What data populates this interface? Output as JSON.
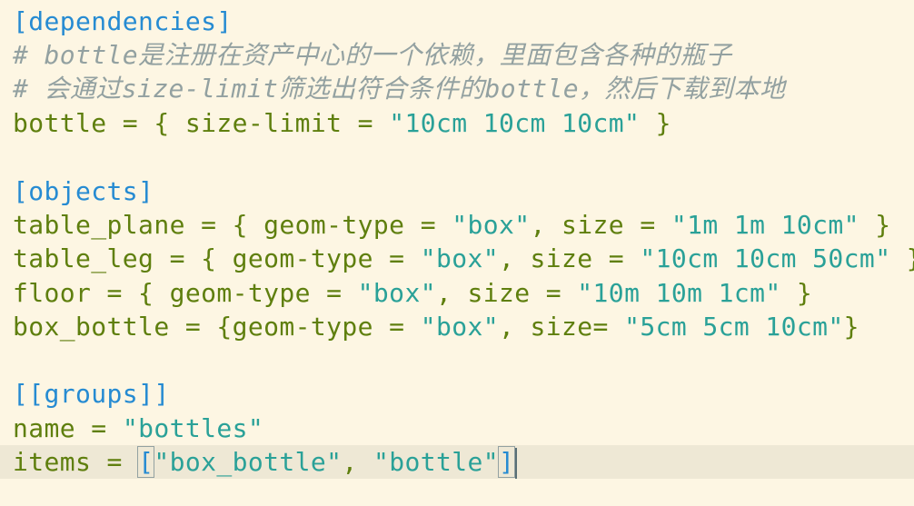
{
  "editor": {
    "lines": [
      {
        "tokens": [
          {
            "t": "section",
            "v": "[dependencies]"
          }
        ]
      },
      {
        "tokens": [
          {
            "t": "comment",
            "v": "# bottle是注册在资产中心的一个依赖，里面包含各种的瓶子"
          }
        ]
      },
      {
        "tokens": [
          {
            "t": "comment",
            "v": "# 会通过size-limit筛选出符合条件的bottle，然后下载到本地"
          }
        ]
      },
      {
        "tokens": [
          {
            "t": "key",
            "v": "bottle = { size-limit = "
          },
          {
            "t": "str",
            "v": "\"10cm 10cm 10cm\""
          },
          {
            "t": "punct",
            "v": " }"
          }
        ]
      },
      {
        "tokens": []
      },
      {
        "tokens": [
          {
            "t": "section",
            "v": "[objects]"
          }
        ]
      },
      {
        "tokens": [
          {
            "t": "key",
            "v": "table_plane = { geom-type = "
          },
          {
            "t": "str",
            "v": "\"box\""
          },
          {
            "t": "punct",
            "v": ", size = "
          },
          {
            "t": "str",
            "v": "\"1m 1m 10cm\""
          },
          {
            "t": "punct",
            "v": " }"
          }
        ]
      },
      {
        "tokens": [
          {
            "t": "key",
            "v": "table_leg = { geom-type = "
          },
          {
            "t": "str",
            "v": "\"box\""
          },
          {
            "t": "punct",
            "v": ", size = "
          },
          {
            "t": "str",
            "v": "\"10cm 10cm 50cm\""
          },
          {
            "t": "punct",
            "v": " }"
          }
        ]
      },
      {
        "tokens": [
          {
            "t": "key",
            "v": "floor = { geom-type = "
          },
          {
            "t": "str",
            "v": "\"box\""
          },
          {
            "t": "punct",
            "v": ", size = "
          },
          {
            "t": "str",
            "v": "\"10m 10m 1cm\""
          },
          {
            "t": "punct",
            "v": " }"
          }
        ]
      },
      {
        "tokens": [
          {
            "t": "key",
            "v": "box_bottle = {geom-type = "
          },
          {
            "t": "str",
            "v": "\"box\""
          },
          {
            "t": "punct",
            "v": ", size= "
          },
          {
            "t": "str",
            "v": "\"5cm 5cm 10cm\""
          },
          {
            "t": "punct",
            "v": "}"
          }
        ]
      },
      {
        "tokens": []
      },
      {
        "tokens": [
          {
            "t": "section",
            "v": "[[groups]]"
          }
        ]
      },
      {
        "tokens": [
          {
            "t": "key",
            "v": "name = "
          },
          {
            "t": "str",
            "v": "\"bottles\""
          }
        ]
      },
      {
        "current": true,
        "tokens": [
          {
            "t": "key",
            "v": "items = "
          },
          {
            "t": "bracket-match",
            "v": "["
          },
          {
            "t": "str",
            "v": "\"box_bottle\""
          },
          {
            "t": "punct",
            "v": ", "
          },
          {
            "t": "str",
            "v": "\"bottle\""
          },
          {
            "t": "bracket-match",
            "v": "]"
          },
          {
            "t": "cursor",
            "v": ""
          }
        ]
      }
    ]
  },
  "colors": {
    "background": "#fdf6e3",
    "current_line": "#eee8d5",
    "section": "#268bd2",
    "comment": "#93a1a1",
    "key": "#5f7f0e",
    "string": "#2aa198"
  }
}
